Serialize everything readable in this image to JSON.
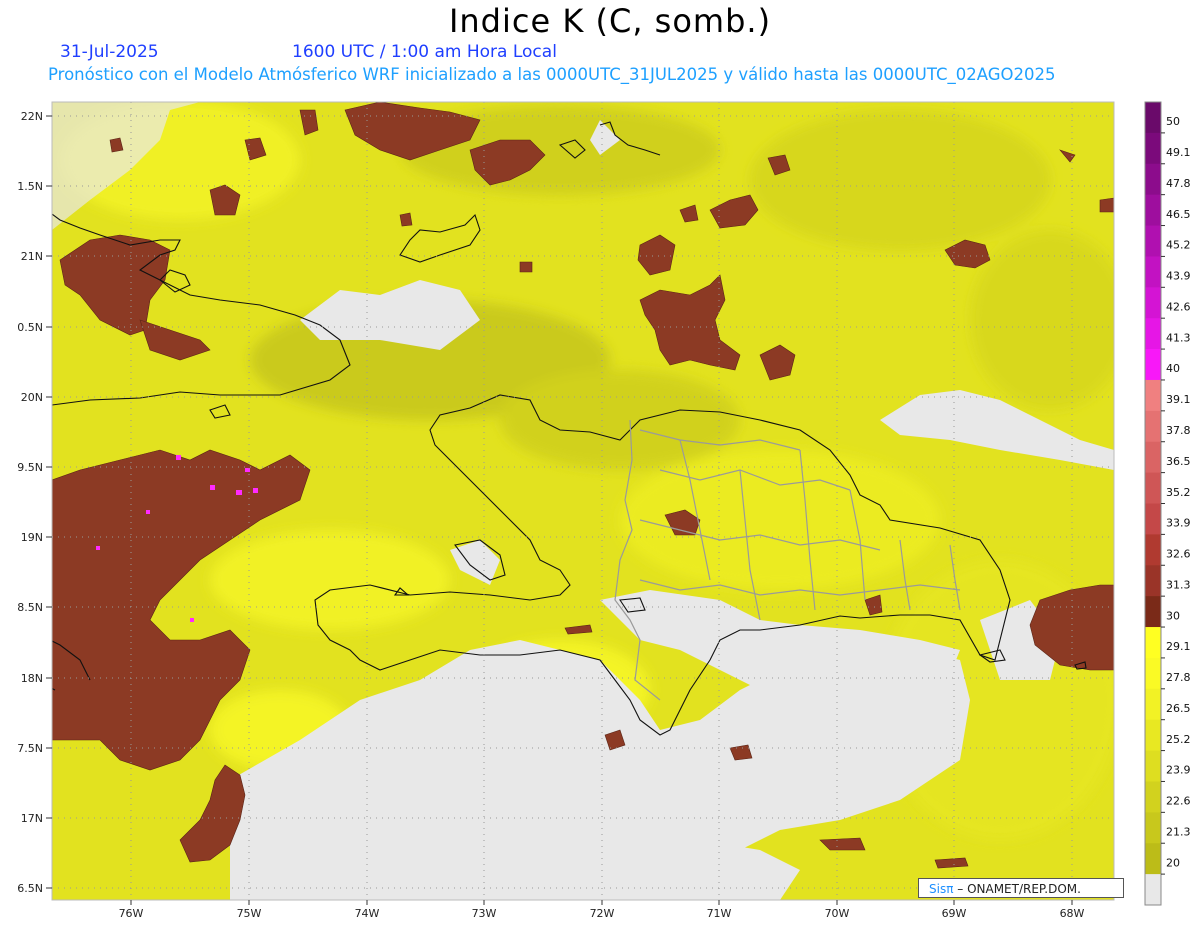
{
  "header": {
    "title": "Indice K (C, somb.)",
    "date": "31-Jul-2025",
    "time": "1600 UTC / 1:00 am Hora Local",
    "subtitle": "Pronóstico con el Modelo Atmósferico WRF inicializado a las 0000UTC_31JUL2025 y válido hasta las  0000UTC_02AGO2025"
  },
  "map": {
    "y_labels": [
      "22N",
      "1.5N",
      "21N",
      "0.5N",
      "20N",
      "9.5N",
      "19N",
      "8.5N",
      "18N",
      "7.5N",
      "17N",
      "6.5N"
    ],
    "x_labels": [
      "76W",
      "75W",
      "74W",
      "73W",
      "72W",
      "71W",
      "70W",
      "69W",
      "68W"
    ]
  },
  "colorbar": {
    "labels": [
      "50",
      "49.1",
      "47.8",
      "46.5",
      "45.2",
      "43.9",
      "42.6",
      "41.3",
      "40",
      "39.1",
      "37.8",
      "36.5",
      "35.2",
      "33.9",
      "32.6",
      "31.3",
      "30",
      "29.1",
      "27.8",
      "26.5",
      "25.2",
      "23.9",
      "22.6",
      "21.3",
      "20"
    ],
    "colors": [
      "#6a0a6a",
      "#7b0a7b",
      "#8c0c8c",
      "#9e0e9e",
      "#b010b0",
      "#c212c2",
      "#d414d4",
      "#e616e6",
      "#f818f8",
      "#f08080",
      "#e57272",
      "#da6464",
      "#cf5656",
      "#c44848",
      "#b03a30",
      "#9a3428",
      "#7a2a18",
      "#ffff22",
      "#fafa25",
      "#f2f225",
      "#e8e822",
      "#dede20",
      "#d2d21e",
      "#c8c81c",
      "#bcbc18",
      "#e8e8e8"
    ]
  },
  "credit": {
    "logo": "Sisπ",
    "text": " – ONAMET/REP.DOM."
  }
}
